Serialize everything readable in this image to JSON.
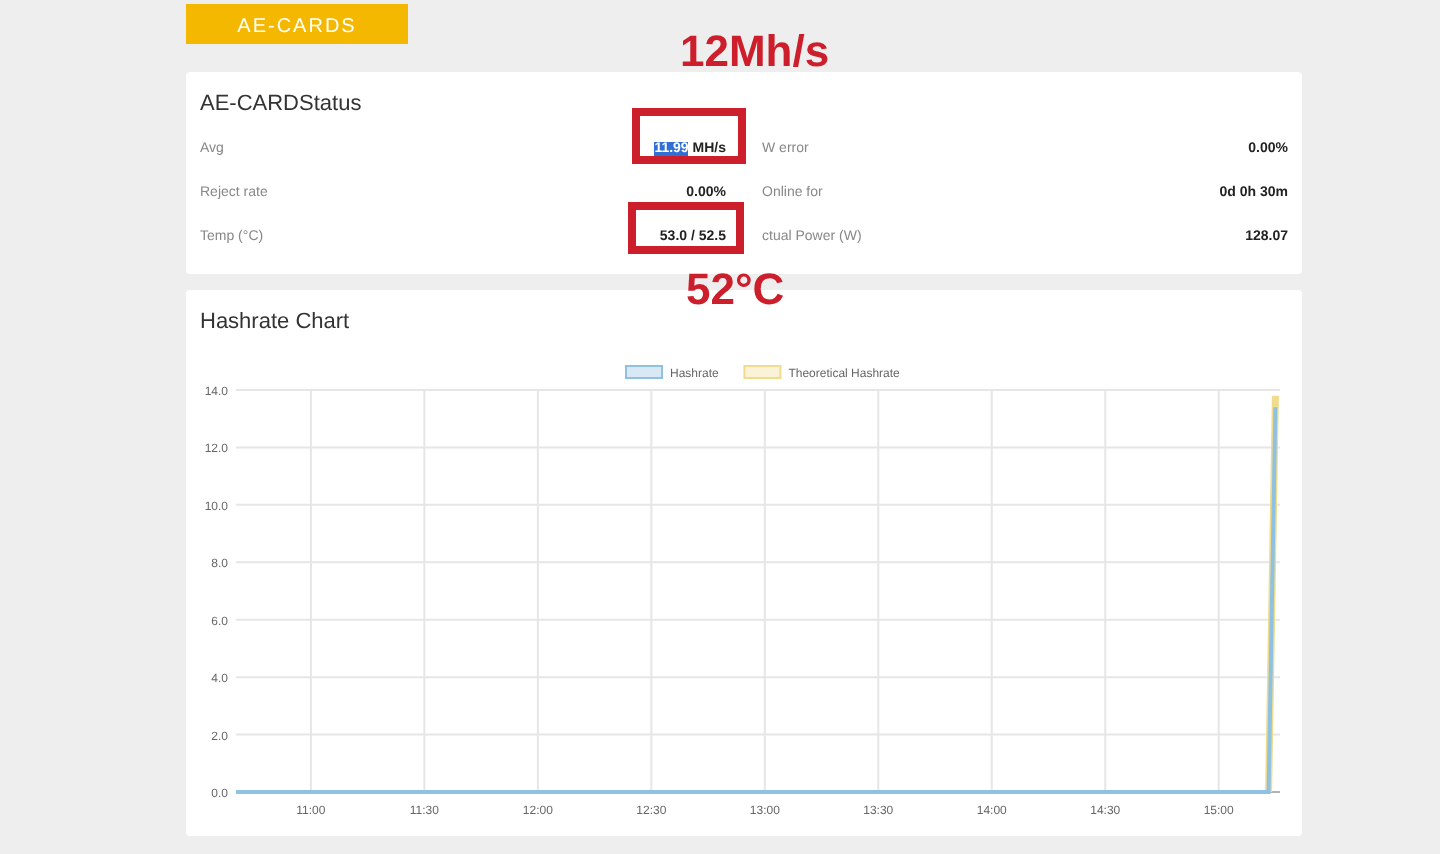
{
  "header_tab": {
    "label": "AE-CARDS"
  },
  "status": {
    "title": "AE-CARDStatus",
    "rows": [
      {
        "label": "Avg",
        "value": "11.99",
        "unit": "MH/s",
        "value_selected": true
      },
      {
        "label": "W error",
        "value": "0.00%"
      },
      {
        "label": "Reject rate",
        "value": "0.00%"
      },
      {
        "label": "Online for",
        "value": "0d 0h 30m"
      },
      {
        "label": "Temp (°C)",
        "value": "53.0 / 52.5"
      },
      {
        "label": "ctual Power (W)",
        "value": "128.07"
      }
    ]
  },
  "chart": {
    "title": "Hashrate Chart",
    "chart_data": {
      "type": "line",
      "x": [
        10.67,
        15.22,
        15.25
      ],
      "series": [
        {
          "name": "Hashrate",
          "color": "#8fc1e3",
          "values": [
            0,
            0,
            13.4
          ]
        },
        {
          "name": "Theoretical Hashrate",
          "color": "#f0dc8c",
          "values": [
            null,
            0,
            13.8
          ]
        }
      ],
      "xlim": [
        10.67,
        15.27
      ],
      "ylim": [
        0,
        14
      ],
      "grid": true,
      "legend": true,
      "xticks": [
        {
          "value": 11,
          "label": "11:00"
        },
        {
          "value": 11.5,
          "label": "11:30"
        },
        {
          "value": 12,
          "label": "12:00"
        },
        {
          "value": 12.5,
          "label": "12:30"
        },
        {
          "value": 13,
          "label": "13:00"
        },
        {
          "value": 13.5,
          "label": "13:30"
        },
        {
          "value": 14,
          "label": "14:00"
        },
        {
          "value": 14.5,
          "label": "14:30"
        },
        {
          "value": 15,
          "label": "15:00"
        }
      ],
      "yticks": [
        {
          "value": 0,
          "label": "0.0"
        },
        {
          "value": 2,
          "label": "2.0"
        },
        {
          "value": 4,
          "label": "4.0"
        },
        {
          "value": 6,
          "label": "6.0"
        },
        {
          "value": 8,
          "label": "8.0"
        },
        {
          "value": 10,
          "label": "10.0"
        },
        {
          "value": 12,
          "label": "12.0"
        },
        {
          "value": 14,
          "label": "14.0"
        }
      ]
    }
  },
  "annotations": [
    {
      "text": "12Mh/s"
    },
    {
      "text": "52°C"
    }
  ]
}
